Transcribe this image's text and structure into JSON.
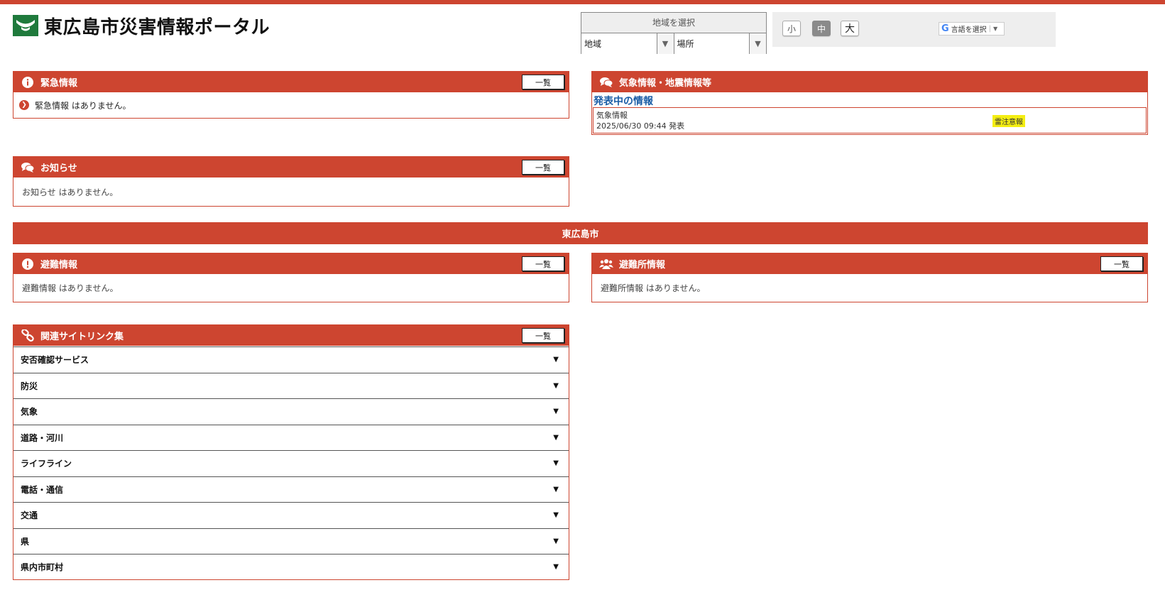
{
  "header": {
    "site_title": "東広島市災害情報ポータル"
  },
  "region_select": {
    "title": "地域を選択",
    "area_value": "地域",
    "place_value": "場所"
  },
  "font_size": {
    "small": "小",
    "medium": "中",
    "large": "大",
    "selected": "中"
  },
  "translate": {
    "g_letter": "G",
    "label": "言語を選択",
    "arrow": "▼"
  },
  "common": {
    "list_button": "一覧"
  },
  "emergency": {
    "title": "緊急情報",
    "message": "緊急情報 はありません。"
  },
  "weather": {
    "title": "気象情報・地震情報等",
    "subheading": "発表中の情報",
    "item_category": "気象情報",
    "item_datetime": "2025/06/30 09:44 発表",
    "item_warning": "雷注意報",
    "warning_color": "#f4ee12"
  },
  "notices": {
    "title": "お知らせ",
    "message": "お知らせ はありません。"
  },
  "city_bar": {
    "label": "東広島市"
  },
  "evacuation": {
    "title": "避難情報",
    "message": "避難情報 はありません。"
  },
  "shelters": {
    "title": "避難所情報",
    "message": "避難所情報 はありません。"
  },
  "links": {
    "title": "関連サイトリンク集",
    "items": [
      {
        "label": "安否確認サービス"
      },
      {
        "label": "防災"
      },
      {
        "label": "気象"
      },
      {
        "label": "道路・河川"
      },
      {
        "label": "ライフライン"
      },
      {
        "label": "電話・通信"
      },
      {
        "label": "交通"
      },
      {
        "label": "県"
      },
      {
        "label": "県内市町村"
      }
    ]
  },
  "colors": {
    "accent": "#cd4530",
    "logo_green": "#1f7a3c",
    "subheading_blue": "#1a5da6"
  }
}
